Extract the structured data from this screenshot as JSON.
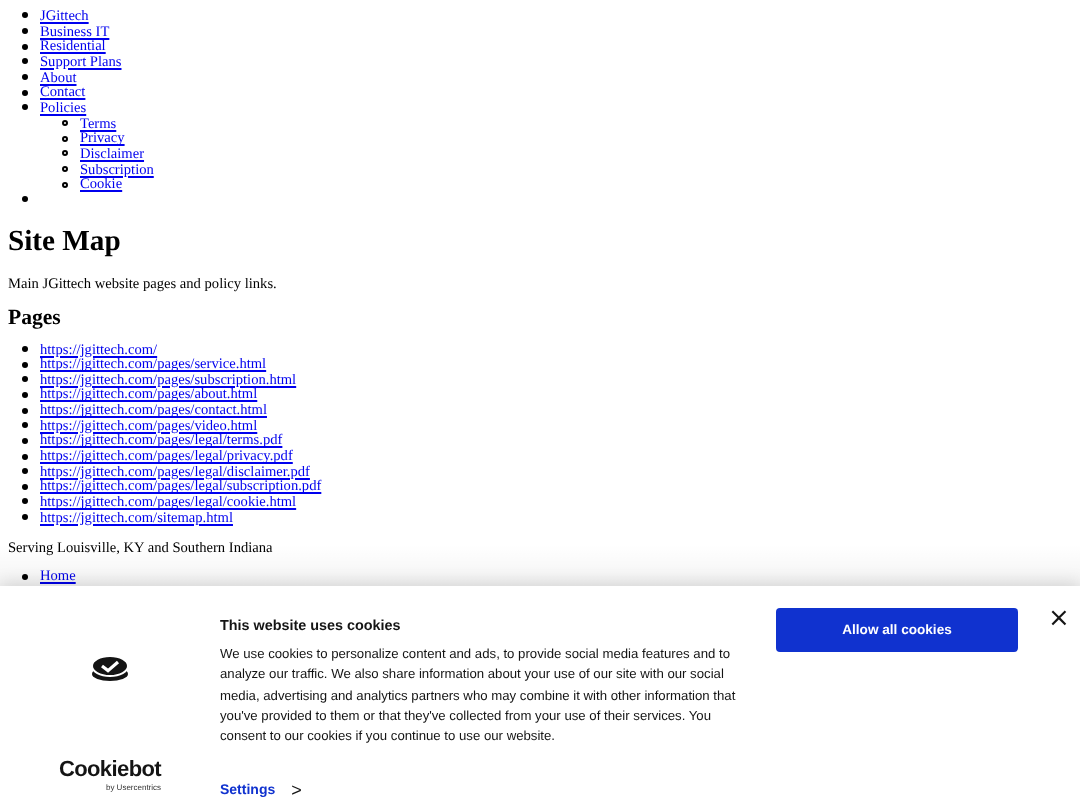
{
  "nav": {
    "items": [
      {
        "kind": "link",
        "label": "JGittech"
      },
      {
        "kind": "link",
        "label": "Business IT"
      },
      {
        "kind": "link",
        "label": "Residential"
      },
      {
        "kind": "link",
        "label": "Support Plans"
      },
      {
        "kind": "link",
        "label": "About"
      },
      {
        "kind": "link",
        "label": "Contact"
      },
      {
        "kind": "link",
        "label": "Policies",
        "children": [
          "Terms",
          "Privacy",
          "Disclaimer",
          "Subscription",
          "Cookie"
        ]
      },
      {
        "kind": "empty"
      }
    ]
  },
  "heading": "Site Map",
  "intro": "Main JGittech website pages and policy links.",
  "pages": {
    "heading": "Pages",
    "links": [
      "https://jgittech.com/",
      "https://jgittech.com/pages/service.html",
      "https://jgittech.com/pages/subscription.html",
      "https://jgittech.com/pages/about.html",
      "https://jgittech.com/pages/contact.html",
      "https://jgittech.com/pages/video.html",
      "https://jgittech.com/pages/legal/terms.pdf",
      "https://jgittech.com/pages/legal/privacy.pdf",
      "https://jgittech.com/pages/legal/disclaimer.pdf",
      "https://jgittech.com/pages/legal/subscription.pdf",
      "https://jgittech.com/pages/legal/cookie.html",
      "https://jgittech.com/sitemap.html"
    ]
  },
  "footer": {
    "text": "Serving Louisville, KY and Southern Indiana",
    "links": [
      "Home"
    ]
  },
  "cookie_banner": {
    "brand": "Cookiebot",
    "brand_sub": "by Usercentrics",
    "title": "This website uses cookies",
    "body": "We use cookies to personalize content and ads, to provide social media features and to analyze our traffic. We also share information about your use of our site with our social media, advertising and analytics partners who may combine it with other information that you've provided to them or that they've collected from your use of their services. You consent to our cookies if you continue to use our website.",
    "settings": "Settings",
    "settings_arrow": ">",
    "allow": "Allow all cookies",
    "close": "×"
  }
}
